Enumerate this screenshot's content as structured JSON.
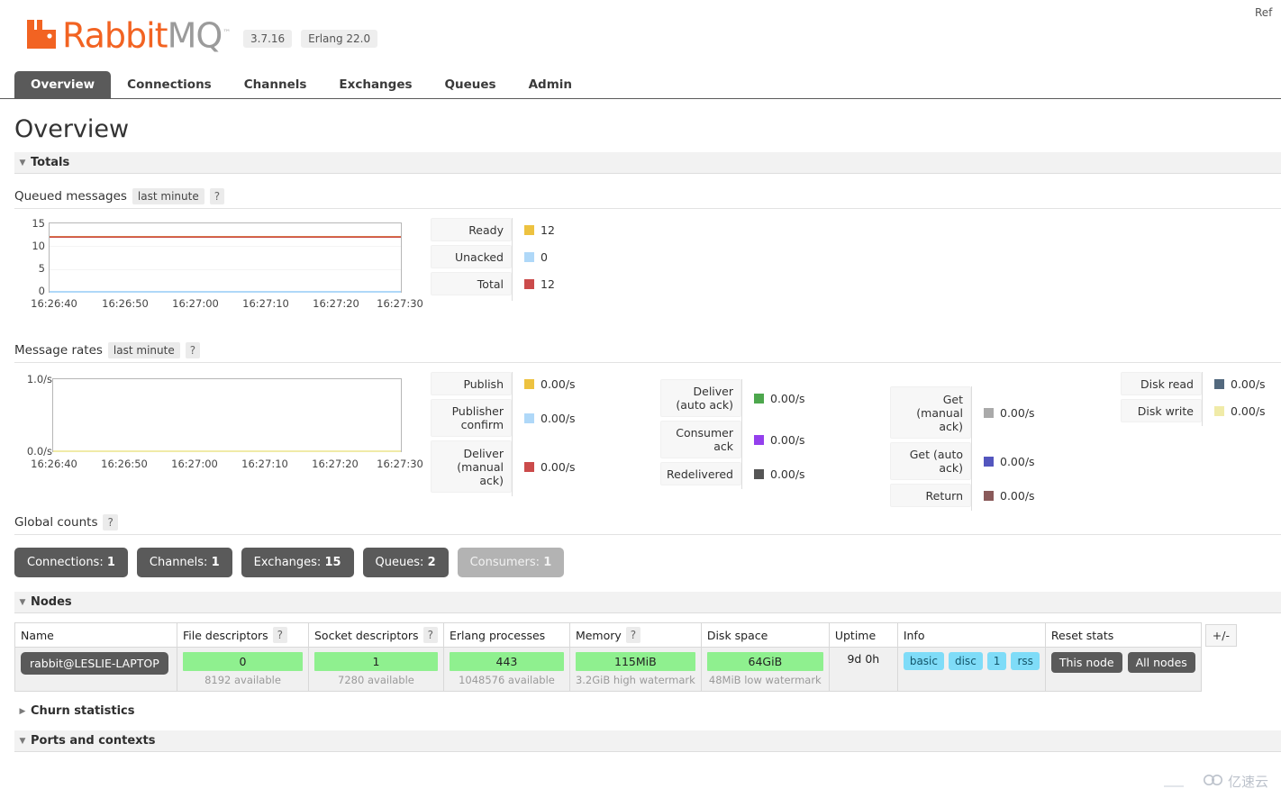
{
  "brand": {
    "name_part1": "Rabbit",
    "name_part2": "MQ",
    "trademark": "™",
    "version": "3.7.16",
    "erlang": "Erlang 22.0",
    "accent": "#F26322"
  },
  "header": {
    "refresh_label": "Ref"
  },
  "nav": {
    "tabs": [
      {
        "label": "Overview",
        "active": true
      },
      {
        "label": "Connections",
        "active": false
      },
      {
        "label": "Channels",
        "active": false
      },
      {
        "label": "Exchanges",
        "active": false
      },
      {
        "label": "Queues",
        "active": false
      },
      {
        "label": "Admin",
        "active": false
      }
    ]
  },
  "page": {
    "title": "Overview"
  },
  "sections": {
    "totals": {
      "label": "Totals",
      "expanded": true,
      "triangle": "▼"
    },
    "nodes": {
      "label": "Nodes",
      "expanded": true,
      "triangle": "▼"
    },
    "churn": {
      "label": "Churn statistics",
      "expanded": false,
      "triangle": "▶"
    },
    "ports": {
      "label": "Ports and contexts",
      "expanded": true,
      "triangle": "▼"
    }
  },
  "queued_messages": {
    "title": "Queued messages",
    "range_pill": "last minute",
    "help_pill": "?",
    "legend": [
      {
        "label": "Ready",
        "value": "12",
        "color": "#EDC240"
      },
      {
        "label": "Unacked",
        "value": "0",
        "color": "#AFD8F8"
      },
      {
        "label": "Total",
        "value": "12",
        "color": "#CB4B4B"
      }
    ]
  },
  "message_rates": {
    "title": "Message rates",
    "range_pill": "last minute",
    "help_pill": "?",
    "columns": [
      {
        "entries": [
          {
            "label": "Publish",
            "value": "0.00/s",
            "color": "#EDC240"
          },
          {
            "label": "Publisher confirm",
            "value": "0.00/s",
            "color": "#AFD8F8"
          },
          {
            "label": "Deliver (manual ack)",
            "value": "0.00/s",
            "color": "#CB4B4B"
          }
        ]
      },
      {
        "entries": [
          {
            "label": "Deliver (auto ack)",
            "value": "0.00/s",
            "color": "#4DA74D"
          },
          {
            "label": "Consumer ack",
            "value": "0.00/s",
            "color": "#9440ED"
          },
          {
            "label": "Redelivered",
            "value": "0.00/s",
            "color": "#555555"
          }
        ]
      },
      {
        "entries": [
          {
            "label": "Get (manual ack)",
            "value": "0.00/s",
            "color": "#AAAAAA"
          },
          {
            "label": "Get (auto ack)",
            "value": "0.00/s",
            "color": "#5356BE"
          },
          {
            "label": "Return",
            "value": "0.00/s",
            "color": "#8A5A5A"
          }
        ]
      },
      {
        "entries": [
          {
            "label": "Disk read",
            "value": "0.00/s",
            "color": "#53697E"
          },
          {
            "label": "Disk write",
            "value": "0.00/s",
            "color": "#F0EBA8"
          }
        ]
      }
    ]
  },
  "global_counts": {
    "title": "Global counts",
    "help_pill": "?",
    "buttons": [
      {
        "label": "Connections:",
        "value": "1",
        "muted": false
      },
      {
        "label": "Channels:",
        "value": "1",
        "muted": false
      },
      {
        "label": "Exchanges:",
        "value": "15",
        "muted": false
      },
      {
        "label": "Queues:",
        "value": "2",
        "muted": false
      },
      {
        "label": "Consumers:",
        "value": "1",
        "muted": true
      }
    ]
  },
  "nodes_table": {
    "headers": {
      "name": "Name",
      "file_descriptors": "File descriptors",
      "file_descriptors_help": "?",
      "socket_descriptors": "Socket descriptors",
      "socket_descriptors_help": "?",
      "erlang_processes": "Erlang processes",
      "memory": "Memory",
      "memory_help": "?",
      "disk_space": "Disk space",
      "uptime": "Uptime",
      "info": "Info",
      "reset_stats": "Reset stats",
      "plusminus": "+/-"
    },
    "row": {
      "name": "rabbit@LESLIE-LAPTOP",
      "file_descriptors": "0",
      "file_descriptors_sub": "8192 available",
      "socket_descriptors": "1",
      "socket_descriptors_sub": "7280 available",
      "erlang_processes": "443",
      "erlang_processes_sub": "1048576 available",
      "memory": "115MiB",
      "memory_sub": "3.2GiB high watermark",
      "disk_space": "64GiB",
      "disk_space_sub": "48MiB low watermark",
      "uptime": "9d 0h",
      "info_tags": [
        "basic",
        "disc",
        "1",
        "rss"
      ],
      "reset_buttons": [
        "This node",
        "All nodes"
      ]
    }
  },
  "watermark": {
    "text": "亿速云"
  },
  "chart_data": [
    {
      "type": "line",
      "title": "Queued messages",
      "xlabel": "",
      "ylabel": "",
      "ylim": [
        0,
        15
      ],
      "yticks": [
        0,
        5,
        10,
        15
      ],
      "ytick_labels": [
        "0",
        "5",
        "10",
        "15"
      ],
      "x": [
        "16:26:40",
        "16:26:50",
        "16:27:00",
        "16:27:10",
        "16:27:20",
        "16:27:30"
      ],
      "grid": true,
      "legend_position": "right",
      "series": [
        {
          "name": "Ready",
          "color": "#EDC240",
          "values": [
            12,
            12,
            12,
            12,
            12,
            12
          ]
        },
        {
          "name": "Unacked",
          "color": "#AFD8F8",
          "values": [
            0,
            0,
            0,
            0,
            0,
            0
          ]
        },
        {
          "name": "Total",
          "color": "#CB4B4B",
          "values": [
            12,
            12,
            12,
            12,
            12,
            12
          ]
        }
      ]
    },
    {
      "type": "line",
      "title": "Message rates",
      "xlabel": "",
      "ylabel": "",
      "ylim": [
        0,
        1
      ],
      "yticks": [
        0,
        1
      ],
      "ytick_labels": [
        "0.0/s",
        "1.0/s"
      ],
      "x": [
        "16:26:40",
        "16:26:50",
        "16:27:00",
        "16:27:10",
        "16:27:20",
        "16:27:30"
      ],
      "grid": false,
      "legend_position": "right",
      "series": [
        {
          "name": "Publish",
          "color": "#EDC240",
          "values": [
            0,
            0,
            0,
            0,
            0,
            0
          ]
        },
        {
          "name": "Publisher confirm",
          "color": "#AFD8F8",
          "values": [
            0,
            0,
            0,
            0,
            0,
            0
          ]
        },
        {
          "name": "Deliver (manual ack)",
          "color": "#CB4B4B",
          "values": [
            0,
            0,
            0,
            0,
            0,
            0
          ]
        },
        {
          "name": "Deliver (auto ack)",
          "color": "#4DA74D",
          "values": [
            0,
            0,
            0,
            0,
            0,
            0
          ]
        },
        {
          "name": "Consumer ack",
          "color": "#9440ED",
          "values": [
            0,
            0,
            0,
            0,
            0,
            0
          ]
        },
        {
          "name": "Redelivered",
          "color": "#555555",
          "values": [
            0,
            0,
            0,
            0,
            0,
            0
          ]
        },
        {
          "name": "Get (manual ack)",
          "color": "#AAAAAA",
          "values": [
            0,
            0,
            0,
            0,
            0,
            0
          ]
        },
        {
          "name": "Get (auto ack)",
          "color": "#5356BE",
          "values": [
            0,
            0,
            0,
            0,
            0,
            0
          ]
        },
        {
          "name": "Return",
          "color": "#8A5A5A",
          "values": [
            0,
            0,
            0,
            0,
            0,
            0
          ]
        },
        {
          "name": "Disk read",
          "color": "#53697E",
          "values": [
            0,
            0,
            0,
            0,
            0,
            0
          ]
        },
        {
          "name": "Disk write",
          "color": "#F0EBA8",
          "values": [
            0,
            0,
            0,
            0,
            0,
            0
          ]
        }
      ]
    }
  ]
}
